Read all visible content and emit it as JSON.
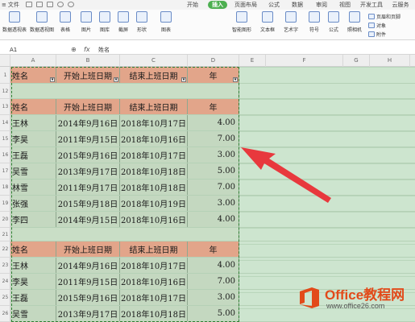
{
  "menubar": {
    "file_label": "文件",
    "tabs": [
      "开始",
      "插入",
      "页面布局",
      "公式",
      "数据",
      "审阅",
      "视图",
      "开发工具",
      "云服务"
    ],
    "active_tab": "插入"
  },
  "ribbon": {
    "big_buttons": [
      "数据透视表",
      "数据透视图",
      "表格",
      "图片",
      "图库",
      "截屏",
      "形状",
      "图表",
      "智能图形",
      "文本框",
      "艺术字",
      "符号",
      "公式",
      "照相机"
    ],
    "small_buttons": [
      "页眉和页脚",
      "对象",
      "附件"
    ]
  },
  "formula_bar": {
    "cell_ref": "A1",
    "zoom_icon": "⊕",
    "fx_label": "fx",
    "content": "姓名"
  },
  "columns": [
    "A",
    "B",
    "C",
    "D",
    "E",
    "F",
    "G",
    "H"
  ],
  "rows": [
    "1",
    "12",
    "13",
    "14",
    "15",
    "16",
    "17",
    "18",
    "19",
    "20",
    "21",
    "22",
    "23",
    "24",
    "25",
    "26"
  ],
  "table": {
    "headers": [
      "姓名",
      "开始上班日期",
      "结束上班日期",
      "年"
    ],
    "block1": [
      [
        "王林",
        "2014年9月16日",
        "2018年10月17日",
        "4.00"
      ],
      [
        "李昊",
        "2011年9月15日",
        "2018年10月16日",
        "7.00"
      ],
      [
        "王磊",
        "2015年9月16日",
        "2018年10月17日",
        "3.00"
      ],
      [
        "吴雪",
        "2013年9月17日",
        "2018年10月18日",
        "5.00"
      ],
      [
        "林雪",
        "2011年9月17日",
        "2018年10月18日",
        "7.00"
      ],
      [
        "张强",
        "2015年9月18日",
        "2018年10月19日",
        "3.00"
      ],
      [
        "李四",
        "2014年9月15日",
        "2018年10月16日",
        "4.00"
      ]
    ],
    "block2": [
      [
        "王林",
        "2014年9月16日",
        "2018年10月17日",
        "4.00"
      ],
      [
        "李昊",
        "2011年9月15日",
        "2018年10月16日",
        "7.00"
      ],
      [
        "王磊",
        "2015年9月16日",
        "2018年10月17日",
        "3.00"
      ],
      [
        "吴雪",
        "2013年9月17日",
        "2018年10月18日",
        "5.00"
      ]
    ]
  },
  "watermark": {
    "title": "Office教程网",
    "url": "www.office26.com"
  },
  "colors": {
    "header_fill": "#e2a58a",
    "data_fill": "#c4d8c0",
    "sheet_bg": "#cde5cf",
    "active_tab": "#4caf50",
    "arrow": "#e8383d"
  }
}
